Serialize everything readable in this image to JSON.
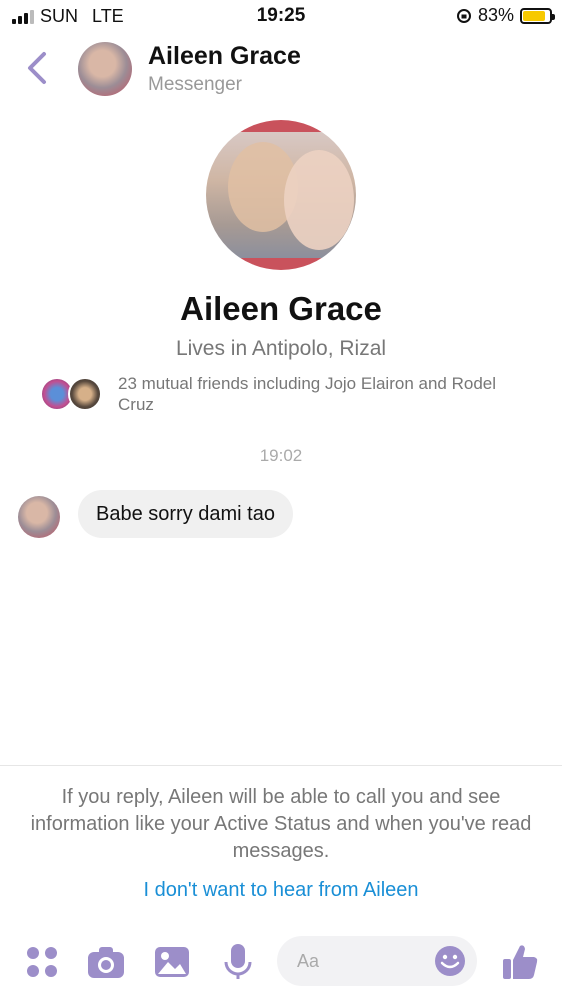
{
  "status_bar": {
    "carrier": "SUN",
    "network": "LTE",
    "time": "19:25",
    "battery_percent": "83%",
    "battery_level": 0.83
  },
  "header": {
    "name": "Aileen Grace",
    "subtitle": "Messenger"
  },
  "profile": {
    "name": "Aileen Grace",
    "location": "Lives in Antipolo, Rizal",
    "mutual_friends": "23 mutual friends including Jojo Elairon and Rodel Cruz"
  },
  "conversation": {
    "timestamp": "19:02",
    "messages": [
      {
        "text": "Babe sorry dami tao"
      }
    ]
  },
  "notice": {
    "text": "If you reply, Aileen will be able to call you and see information like your Active Status and when you've read messages.",
    "link": "I don't want to hear from Aileen"
  },
  "composer": {
    "placeholder": "Aa"
  },
  "colors": {
    "accent": "#9c8ec9",
    "link": "#1a8fd6",
    "battery": "#f7c900"
  }
}
